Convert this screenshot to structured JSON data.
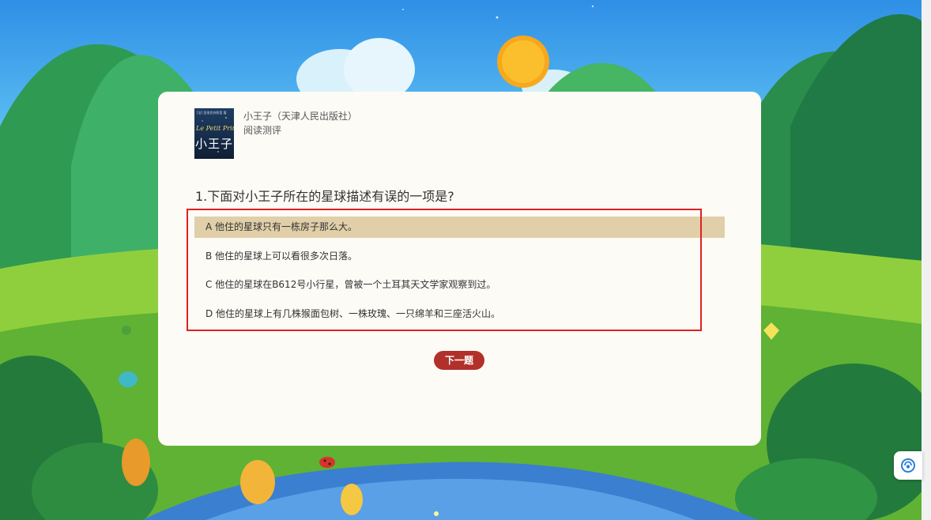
{
  "book": {
    "cover_small_text": "[法] 圣埃克苏佩里 著",
    "cover_script": "Le Petit Prince",
    "cover_title": "小王子",
    "title": "小王子（天津人民出版社）",
    "subtitle": "阅读测评"
  },
  "quiz": {
    "question": "1.下面对小王子所在的星球描述有误的一项是?",
    "options": [
      {
        "label": "A 他住的星球只有一栋房子那么大。",
        "selected": true
      },
      {
        "label": "B 他住的星球上可以看很多次日落。",
        "selected": false
      },
      {
        "label": "C 他住的星球在B612号小行星，曾被一个土耳其天文学家观察到过。",
        "selected": false
      },
      {
        "label": "D 他住的星球上有几株猴面包树、一株玫瑰、一只绵羊和三座活火山。",
        "selected": false
      }
    ],
    "next_label": "下一题"
  },
  "colors": {
    "card_bg": "#fdfbf6",
    "selected_option_bg": "#e0cfa9",
    "next_button": "#b2302a",
    "highlight_border": "#e02020"
  },
  "icons": {
    "floating_widget": "assistant-icon"
  }
}
